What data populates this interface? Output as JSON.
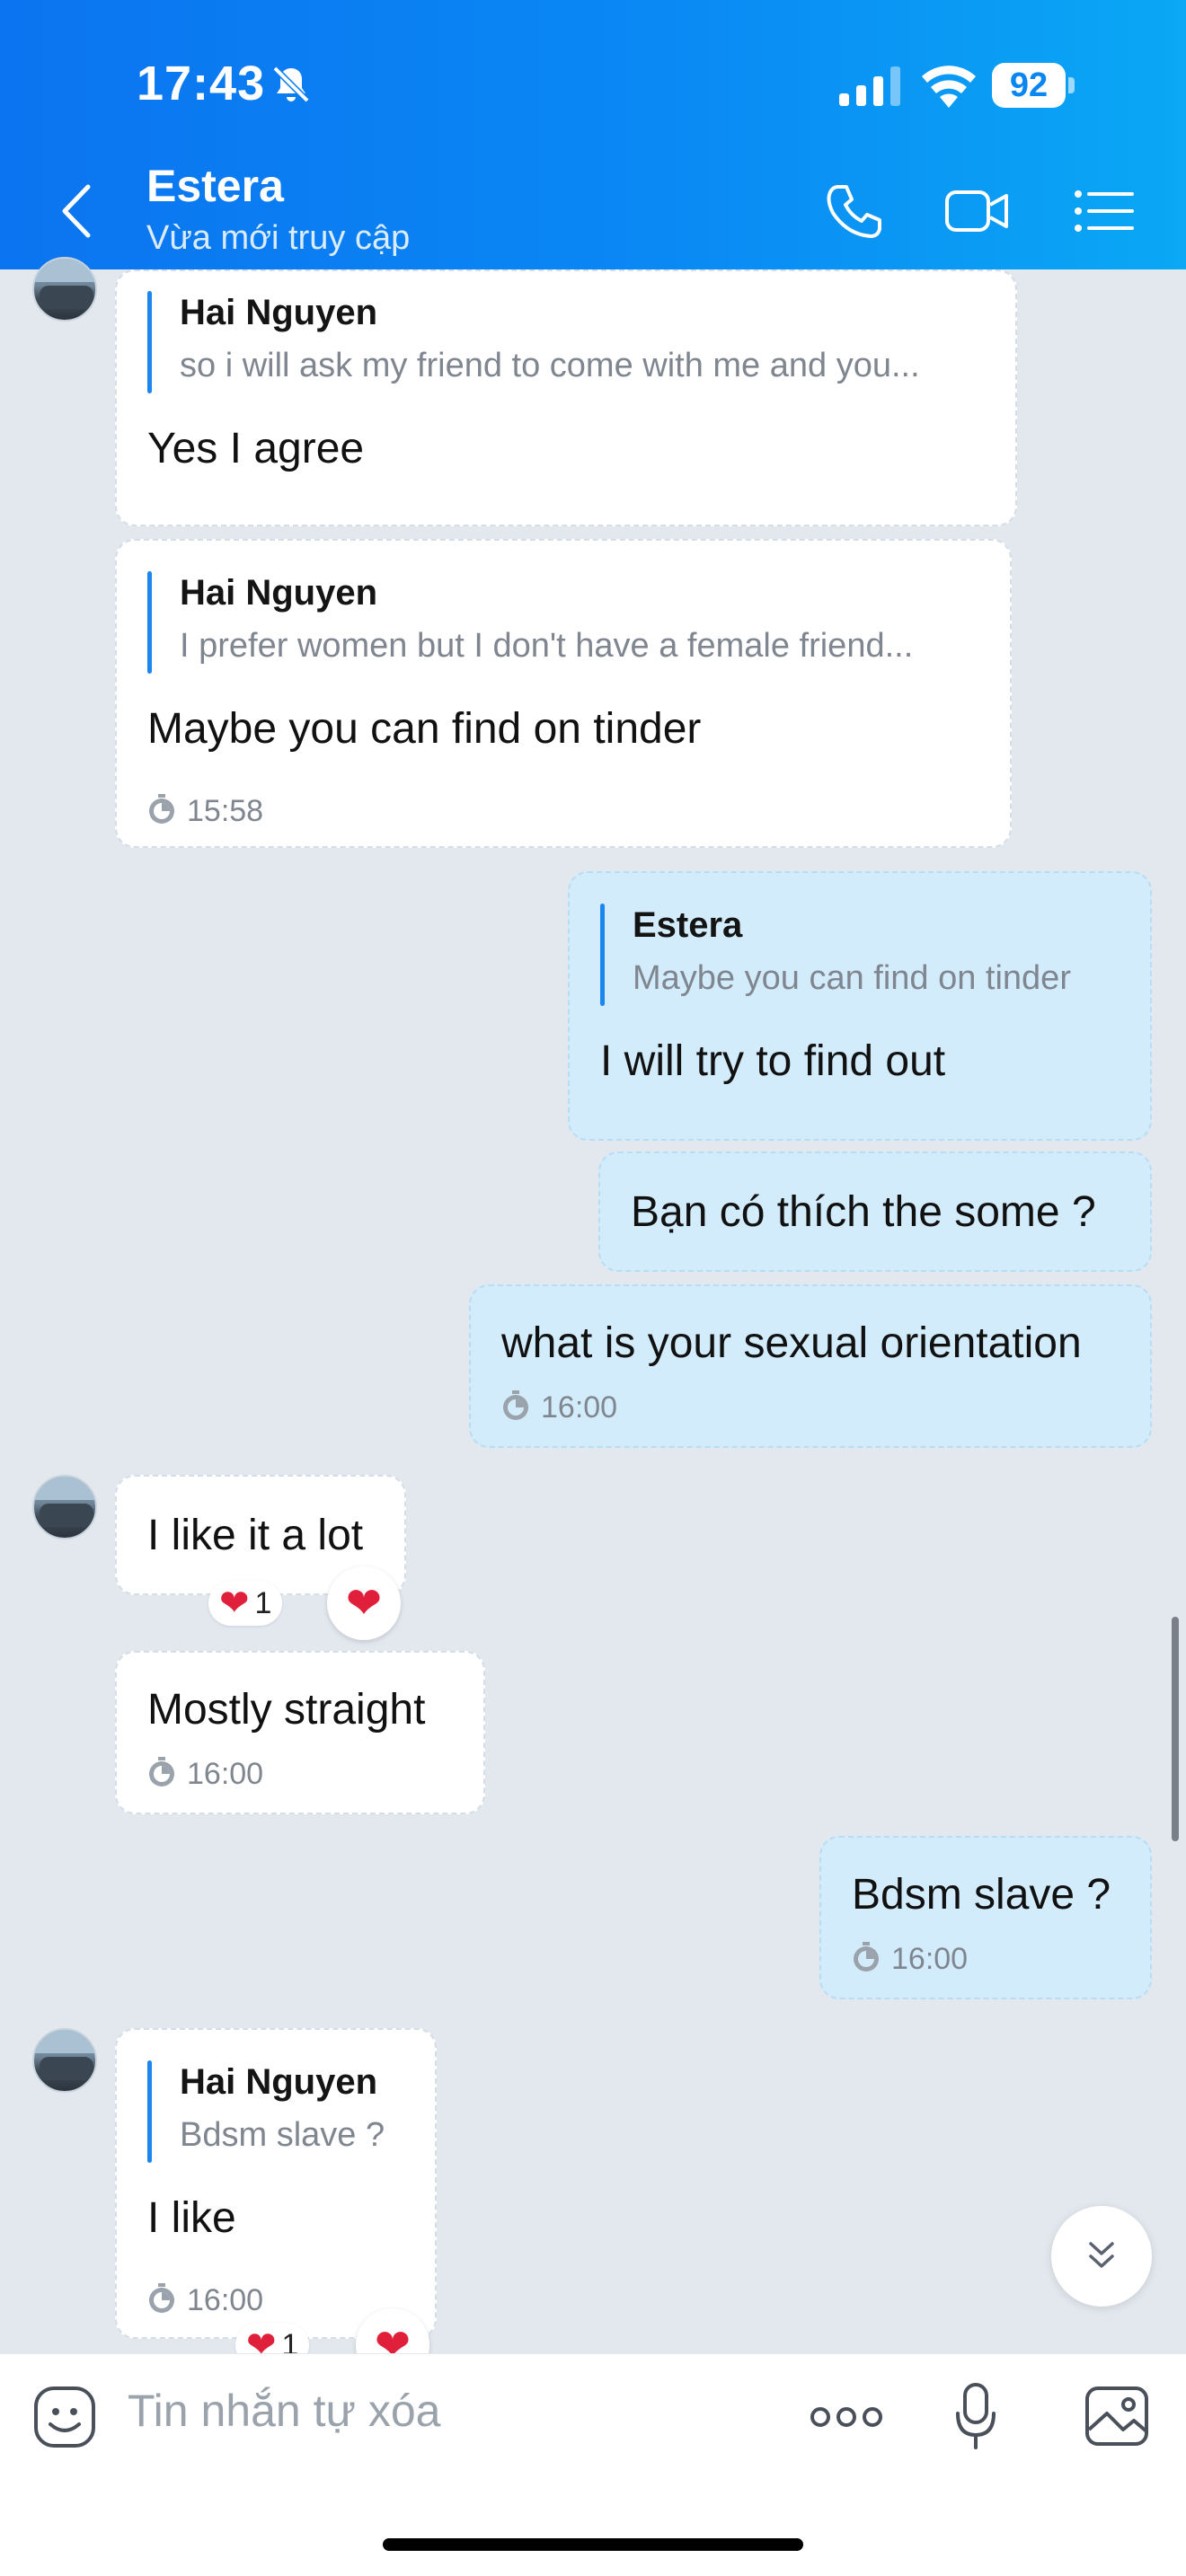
{
  "status_bar": {
    "time": "17:43",
    "battery": "92"
  },
  "header": {
    "name": "Estera",
    "status": "Vừa mới truy cập"
  },
  "messages": {
    "m1": {
      "quote_author": "Hai Nguyen",
      "quote_text": "so i will ask my friend to come with me and you...",
      "text": "Yes I agree"
    },
    "m2": {
      "quote_author": "Hai Nguyen",
      "quote_text": "I prefer women but I don't have a female friend...",
      "text": "Maybe you can find on tinder",
      "time": "15:58"
    },
    "m3": {
      "quote_author": "Estera",
      "quote_text": "Maybe you can find on tinder",
      "text": "I will try to find out"
    },
    "m4": {
      "text": "Bạn có thích the some ?"
    },
    "m5": {
      "text": "what is your sexual orientation",
      "time": "16:00"
    },
    "m6": {
      "text": "I like it a lot",
      "reaction_count": "1"
    },
    "m7": {
      "text": "Mostly straight",
      "time": "16:00"
    },
    "m8": {
      "text": "Bdsm slave ?",
      "time": "16:00"
    },
    "m9": {
      "quote_author": "Hai Nguyen",
      "quote_text": "Bdsm slave ?",
      "text": "I like",
      "time": "16:00",
      "reaction_count": "1"
    }
  },
  "composer": {
    "placeholder": "Tin nhắn tự xóa"
  },
  "icons": [
    "bell-off-icon",
    "signal-icon",
    "wifi-icon",
    "battery-icon",
    "back-icon",
    "phone-icon",
    "video-icon",
    "menu-list-icon",
    "timer-icon",
    "heart-icon",
    "chevron-double-down-icon",
    "emoji-icon",
    "more-icon",
    "mic-icon",
    "image-icon"
  ],
  "colors": {
    "header_start": "#0b74f0",
    "header_end": "#0aa8f5",
    "outgoing_bubble": "#d3ecfb",
    "incoming_bubble": "#ffffff",
    "background": "#e3e8ef",
    "quote_bar": "#1a86ee"
  }
}
